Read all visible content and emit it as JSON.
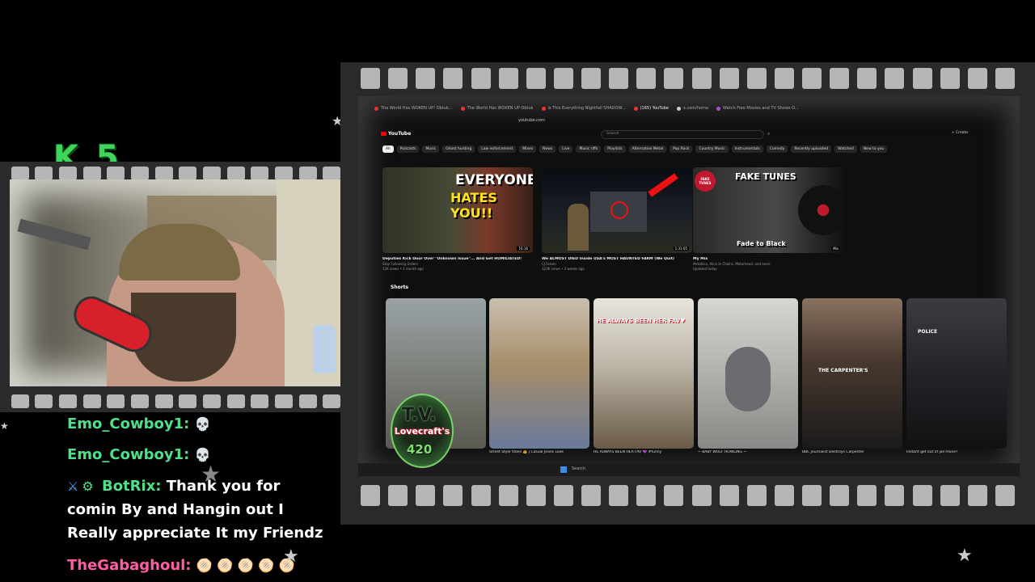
{
  "overlay": {
    "logo_text": "K 5"
  },
  "chat": [
    {
      "user": "Emo_Cowboy1:",
      "message": "💀"
    },
    {
      "user": "Emo_Cowboy1:",
      "message": "💀"
    },
    {
      "user": "BotRix:",
      "message": "Thank you for comin By and Hangin out I Really appreciate It my Friendz"
    },
    {
      "user": "TheGabaghoul:",
      "message": "🫓 🫓 🫓 🫓 🫓"
    }
  ],
  "browser": {
    "tabs": [
      "The World Has WOKEN UP! Obtuk...",
      "The World Has WOKEN UP Obtuk",
      "Is This Everything Nightfall SHADOW...",
      "(165) YouTube",
      "x.com/home",
      "Watch Free Movies and TV Shows O..."
    ],
    "url": "youtube.com"
  },
  "youtube": {
    "logo": "YouTube",
    "search_placeholder": "Search",
    "create_label": "+ Create",
    "chips": [
      "All",
      "Podcasts",
      "Music",
      "Ghost hunting",
      "Law enforcement",
      "Mixes",
      "News",
      "Live",
      "Music riffs",
      "Playlists",
      "Alternative Metal",
      "Pop Rock",
      "Country Music",
      "Instrumentals",
      "Comedy",
      "Recently uploaded",
      "Watched",
      "New to you"
    ],
    "videos": [
      {
        "title": "Deputies Kick Door Over \"Unknown Issue\"... And Get HUMILIATED!",
        "channel": "Stop Following Orders",
        "meta": "12K views • 1 month ago",
        "duration": "16:16",
        "thumb_text1": "EVERYONE",
        "thumb_text2": "HATES YOU!!"
      },
      {
        "title": "We ALMOST DIED Inside USA's MOST HAUNTED FARM (We Quit)",
        "channel": "CJ Faison",
        "meta": "323K views • 3 weeks ago",
        "duration": "1:31:05"
      },
      {
        "title": "My Mix",
        "channel": "Metallica, Alice In Chains, Motorhead, and more",
        "meta": "Updated today",
        "duration": "Mix",
        "thumb_text1": "FAKE TUNES",
        "thumb_text2": "Fade to Black",
        "badge": "FAKE TUNES"
      }
    ],
    "shorts_label": "Shorts",
    "shorts": [
      {
        "title": "",
        "caption": ""
      },
      {
        "title": "Street Style Vibes 💰 | Casual Jeans Look",
        "caption": ""
      },
      {
        "title": "HE ALWAYS BEEN HER FAV 💜 #funny",
        "caption": "HE ALWAYS BEEN HER FAV♥"
      },
      {
        "title": "~ BABY WOLF HOWLING ~",
        "caption": ""
      },
      {
        "title": "BBC Journalist Destroys Carpenter",
        "caption": "THE CARPENTER'S"
      },
      {
        "title": "Instant get out of jail move?",
        "caption": "POLICE"
      }
    ]
  },
  "tv_logo": {
    "top": "T.V.",
    "name": "Lovecraft's",
    "number": "420"
  },
  "colors": {
    "chat_user": "#4fe08a",
    "chat_user_alt": "#ff5fa2",
    "logo_green": "#3fd45a",
    "yt_red": "#ff0000"
  }
}
